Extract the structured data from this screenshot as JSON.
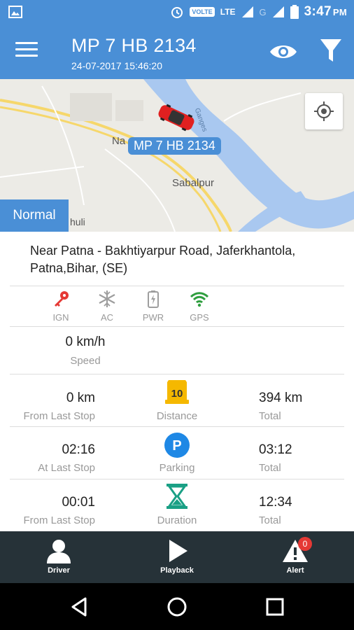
{
  "status_bar": {
    "time": "3:47",
    "ampm": "PM",
    "volte": "VOLTE",
    "lte": "LTE",
    "g": "G"
  },
  "header": {
    "title": "MP 7 HB 2134",
    "timestamp": "24-07-2017 15:46:20"
  },
  "map": {
    "vehicle_tag": "MP 7 HB 2134",
    "mode_badge": "Normal",
    "labels": {
      "place1": "Na",
      "place2": "Sabalpur",
      "place3": "huli",
      "river": "Ganges"
    }
  },
  "address": "Near Patna - Bakhtiyarpur Road, Jaferkhantola, Patna,Bihar, (SE)",
  "status_icons": [
    {
      "label": "IGN",
      "icon": "key-icon",
      "color": "#e53935"
    },
    {
      "label": "AC",
      "icon": "snowflake-icon",
      "color": "#9e9e9e"
    },
    {
      "label": "PWR",
      "icon": "battery-icon",
      "color": "#9e9e9e"
    },
    {
      "label": "GPS",
      "icon": "wifi-icon",
      "color": "#2e9e3e"
    }
  ],
  "speed": {
    "value": "0 km/h",
    "label": "Speed"
  },
  "metrics": {
    "distance": {
      "left_value": "0 km",
      "left_label": "From Last Stop",
      "mid_label": "Distance",
      "right_value": "394 km",
      "right_label": "Total",
      "icon_text": "10"
    },
    "parking": {
      "left_value": "02:16",
      "left_label": "At Last Stop",
      "mid_label": "Parking",
      "right_value": "03:12",
      "right_label": "Total",
      "icon_text": "P"
    },
    "duration": {
      "left_value": "00:01",
      "left_label": "From Last Stop",
      "mid_label": "Duration",
      "right_value": "12:34",
      "right_label": "Total"
    }
  },
  "bottom_nav": {
    "driver": "Driver",
    "playback": "Playback",
    "alert": "Alert",
    "alert_count": "0"
  },
  "colors": {
    "primary": "#4a8fd6",
    "nav_bg": "#263238",
    "parking_blue": "#1e88e5",
    "distance_yellow": "#f5b800",
    "duration_green": "#1aa085"
  }
}
